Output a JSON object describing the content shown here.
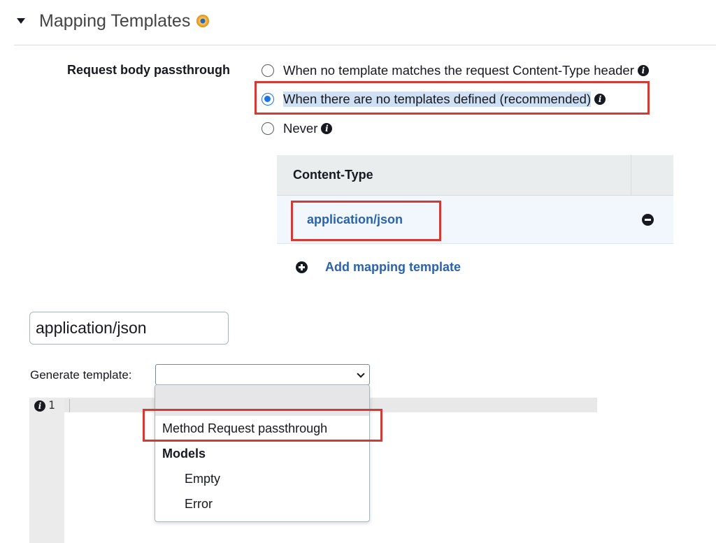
{
  "section": {
    "title": "Mapping Templates"
  },
  "passthrough": {
    "label": "Request body passthrough",
    "options": [
      {
        "label": "When no template matches the request Content-Type header",
        "checked": false
      },
      {
        "label": "When there are no templates defined (recommended)",
        "checked": true
      },
      {
        "label": "Never",
        "checked": false
      }
    ]
  },
  "content_type_table": {
    "header": "Content-Type",
    "rows": [
      {
        "label": "application/json"
      }
    ],
    "add_label": "Add mapping template"
  },
  "content_type_input": {
    "value": "application/json"
  },
  "generate_template": {
    "label": "Generate template:",
    "selected": "",
    "options": [
      {
        "label": "",
        "kind": "blank"
      },
      {
        "label": "Method Request passthrough",
        "kind": "option"
      },
      {
        "label": "Models",
        "kind": "group"
      },
      {
        "label": "Empty",
        "kind": "sub"
      },
      {
        "label": "Error",
        "kind": "sub"
      }
    ]
  },
  "editor": {
    "line_number": "1"
  },
  "colors": {
    "link": "#2b63ab",
    "highlight": "#d13b35",
    "radio_accent": "#1a73e8"
  },
  "icons": {
    "collapse": "caret-down-icon",
    "status": "status-dot-icon",
    "info": "info-circle-icon",
    "remove": "minus-circle-icon",
    "add": "plus-circle-icon",
    "select": "chevron-down-icon"
  }
}
